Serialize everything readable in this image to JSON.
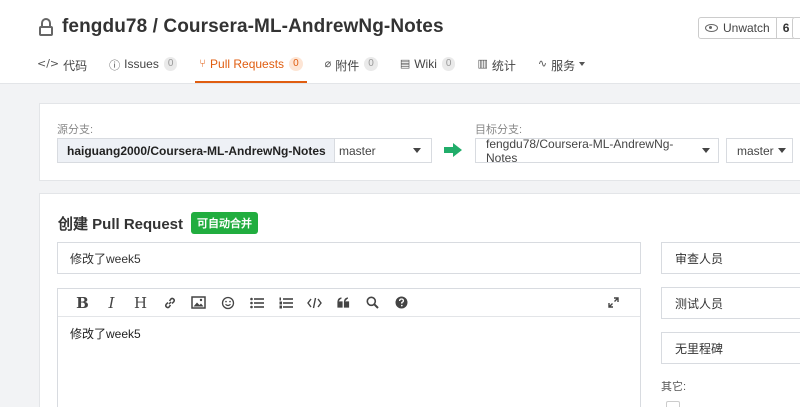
{
  "header": {
    "repo_title": "fengdu78 / Coursera-ML-AndrewNg-Notes",
    "unwatch_label": "Unwatch",
    "unwatch_count": "6"
  },
  "tabs": [
    {
      "label": "代码",
      "icon": "code-icon",
      "badge": ""
    },
    {
      "label": "Issues",
      "icon": "issue-icon",
      "badge": "0"
    },
    {
      "label": "Pull Requests",
      "icon": "pull-request-icon",
      "badge": "0",
      "active": true
    },
    {
      "label": "附件",
      "icon": "attachment-icon",
      "badge": "0"
    },
    {
      "label": "Wiki",
      "icon": "wiki-icon",
      "badge": "0"
    },
    {
      "label": "统计",
      "icon": "stats-icon",
      "badge": ""
    },
    {
      "label": "服务",
      "icon": "pulse-icon",
      "badge": ""
    }
  ],
  "branch": {
    "source_label": "源分支:",
    "source_repo": "haiguang2000/Coursera-ML-AndrewNg-Notes",
    "source_branch": "master",
    "target_label": "目标分支:",
    "target_repo": "fengdu78/Coursera-ML-AndrewNg-Notes",
    "target_branch": "master"
  },
  "pr": {
    "heading": "创建 Pull Request",
    "auto_merge_badge": "可自动合并",
    "title_value": "修改了week5",
    "body_value": "修改了week5",
    "reviewers_label": "审查人员",
    "testers_label": "测试人员",
    "milestone_label": "无里程碑",
    "other_label": "其它:"
  },
  "colors": {
    "accent": "#e05d10",
    "success": "#21ad3f",
    "arrow": "#21ad6a"
  }
}
